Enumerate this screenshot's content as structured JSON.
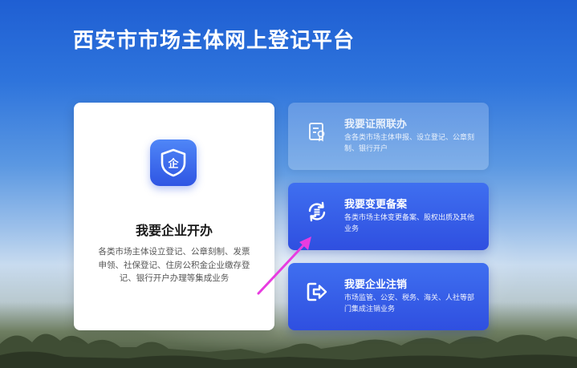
{
  "header": {
    "title": "西安市市场主体网上登记平台"
  },
  "main_card": {
    "icon": "enterprise-shield-icon",
    "icon_char": "企",
    "title": "我要企业开办",
    "description": "各类市场主体设立登记、公章刻制、发票申领、社保登记、住房公积金企业缴存登记、银行开户办理等集成业务"
  },
  "side_cards": [
    {
      "icon": "license-certificate-icon",
      "title": "我要证照联办",
      "description": "含各类市场主体申报、设立登记、公章刻制、银行开户",
      "state": "disabled"
    },
    {
      "icon": "change-filing-icon",
      "title": "我要变更备案",
      "description": "各类市场主体变更备案、股权出质及其他业务",
      "state": "active"
    },
    {
      "icon": "deregister-exit-icon",
      "title": "我要企业注销",
      "description": "市场监管、公安、税务、海关、人社等部门集成注销业务",
      "state": "active"
    }
  ],
  "colors": {
    "accent_blue": "#2f55e3",
    "annotation_arrow": "#e83ce0"
  }
}
